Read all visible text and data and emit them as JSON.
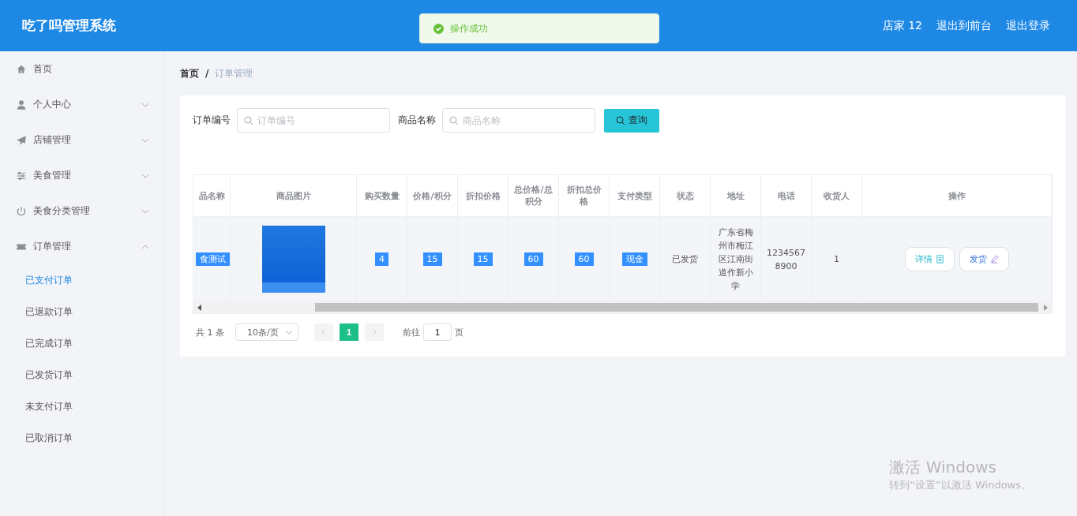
{
  "header": {
    "title": "吃了吗管理系统",
    "links": [
      "店家 12",
      "退出到前台",
      "退出登录"
    ]
  },
  "toast": {
    "kind": "success",
    "text": "操作成功"
  },
  "sidebar": {
    "items": [
      {
        "label": "首页",
        "kind": "link"
      },
      {
        "label": "个人中心",
        "kind": "group",
        "expanded": false
      },
      {
        "label": "店铺管理",
        "kind": "group",
        "expanded": false
      },
      {
        "label": "美食管理",
        "kind": "group",
        "expanded": false
      },
      {
        "label": "美食分类管理",
        "kind": "group",
        "expanded": false
      },
      {
        "label": "订单管理",
        "kind": "group",
        "expanded": true,
        "children": [
          {
            "label": "已支付订单",
            "selected": true
          },
          {
            "label": "已退款订单",
            "selected": false
          },
          {
            "label": "已完成订单",
            "selected": false
          },
          {
            "label": "已发货订单",
            "selected": false
          },
          {
            "label": "未支付订单",
            "selected": false
          },
          {
            "label": "已取消订单",
            "selected": false
          }
        ]
      }
    ]
  },
  "breadcrumb": {
    "items": [
      "首页",
      "订单管理"
    ],
    "separator": "/"
  },
  "search": {
    "fields": [
      {
        "label": "订单编号",
        "placeholder": "订单编号"
      },
      {
        "label": "商品名称",
        "placeholder": "商品名称"
      }
    ],
    "button": "查询"
  },
  "table": {
    "columns": [
      "品名称",
      "商品图片",
      "购买数量",
      "价格/积分",
      "折扣价格",
      "总价格/总积分",
      "折扣总价格",
      "支付类型",
      "状态",
      "地址",
      "电话",
      "收货人",
      "操作"
    ],
    "rows": [
      {
        "cells": [
          {
            "kind": "text",
            "text": "食测试",
            "highlighted": true
          },
          {
            "kind": "image"
          },
          {
            "kind": "text",
            "text": "4",
            "highlighted": true
          },
          {
            "kind": "text",
            "text": "15",
            "highlighted": true
          },
          {
            "kind": "text",
            "text": "15",
            "highlighted": true
          },
          {
            "kind": "text",
            "text": "60",
            "highlighted": true
          },
          {
            "kind": "text",
            "text": "60",
            "highlighted": true
          },
          {
            "kind": "text",
            "text": "现金",
            "highlighted": true
          },
          {
            "kind": "text",
            "text": "已发货",
            "highlighted": false
          },
          {
            "kind": "text",
            "text": "广东省梅州市梅江区江南街道作新小学",
            "highlighted": false
          },
          {
            "kind": "text",
            "text": "12345678900",
            "highlighted": false
          },
          {
            "kind": "text",
            "text": "1",
            "highlighted": false
          },
          {
            "kind": "actions",
            "buttons": [
              {
                "kind": "detail",
                "label": "详情"
              },
              {
                "kind": "ship",
                "label": "发货"
              }
            ]
          }
        ]
      }
    ]
  },
  "pagination": {
    "total": "共 1 条",
    "page_size": "10条/页",
    "pages": [
      {
        "label": "1",
        "selected": true
      }
    ],
    "goto_label": "前往",
    "goto_value": "1",
    "goto_suffix": "页"
  },
  "os_notice": {
    "title": "激活 Windows",
    "text": "转到“设置”以激活 Windows。"
  }
}
